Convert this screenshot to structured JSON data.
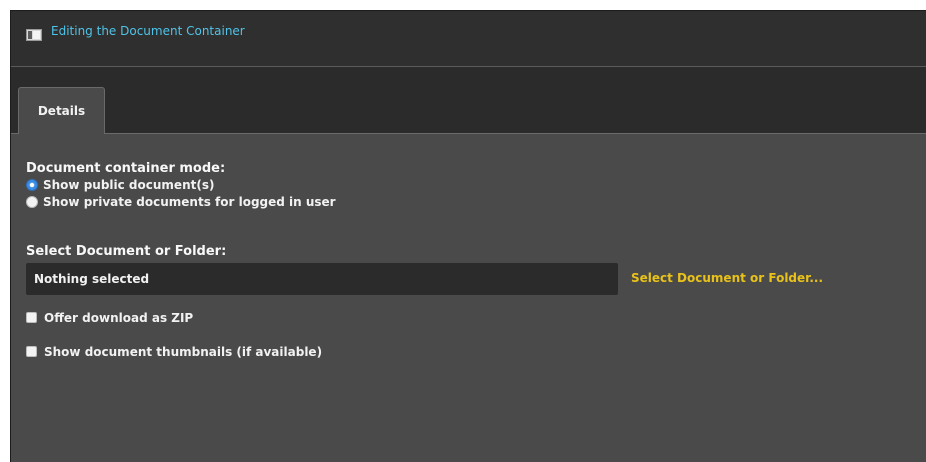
{
  "window": {
    "title": "Editing the Document Container",
    "icon": "panel-icon",
    "accent_color": "#4fc3e8"
  },
  "tabs": [
    {
      "label": "Details",
      "active": true
    }
  ],
  "mode": {
    "label": "Document container mode:",
    "options": [
      {
        "label": "Show public document(s)",
        "checked": true
      },
      {
        "label": "Show private documents for logged in user",
        "checked": false
      }
    ]
  },
  "selection": {
    "label": "Select Document or Folder:",
    "value": "Nothing selected",
    "link_label": "Select Document or Folder...",
    "link_color": "#e8c21a"
  },
  "options": {
    "zip_label": "Offer download as ZIP",
    "zip_checked": false,
    "thumbs_label": "Show document thumbnails (if available)",
    "thumbs_checked": false
  }
}
